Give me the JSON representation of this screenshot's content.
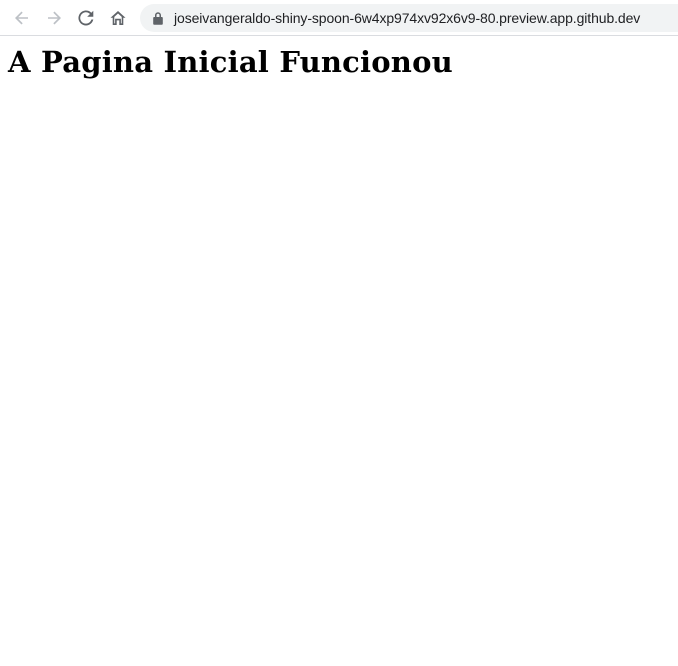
{
  "browser": {
    "url": "joseivangeraldo-shiny-spoon-6w4xp974xv92x6v9-80.preview.app.github.dev",
    "icons": {
      "back": "arrow-left-icon",
      "forward": "arrow-right-icon",
      "reload": "reload-icon",
      "home": "home-icon",
      "lock": "lock-icon"
    }
  },
  "page": {
    "heading": "A Pagina Inicial Funcionou"
  },
  "colors": {
    "toolbar_bg": "#ffffff",
    "omnibox_bg": "#f1f3f4",
    "icon_disabled": "#bdc1c6",
    "icon_enabled": "#5f6368",
    "text": "#202124"
  }
}
